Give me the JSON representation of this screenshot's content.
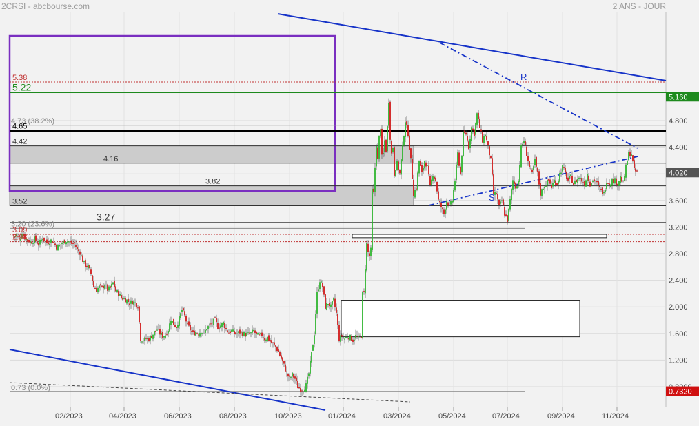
{
  "header": {
    "left": "2CRSI - abcbourse.com",
    "right": "2 ANS - JOUR"
  },
  "chart_data": {
    "type": "candlestick",
    "ylim": [
      0.6,
      5.45
    ],
    "y_ticks": [
      "5.200",
      "4.800",
      "4.400",
      "4.000",
      "3.600",
      "3.200",
      "2.800",
      "2.400",
      "2.000",
      "1.600",
      "1.200",
      "0.8000"
    ],
    "x_ticks": [
      "02/2023",
      "04/2023",
      "06/2023",
      "08/2023",
      "10/2023",
      "01/2024",
      "03/2024",
      "05/2024",
      "07/2024",
      "09/2024",
      "11/2024"
    ],
    "last_price": "4.020",
    "price_tags": [
      {
        "label": "5.160",
        "value": 5.16,
        "color": "#1e8a1e"
      },
      {
        "label": "0.7320",
        "value": 0.732,
        "color": "#d01010"
      }
    ],
    "level_labels": [
      {
        "text": "5.38",
        "value": 5.38,
        "color": "#c03030"
      },
      {
        "text": "5.22",
        "value": 5.22,
        "color": "#1e8a1e"
      },
      {
        "text": "4.73  (38.2%)",
        "value": 4.73,
        "color": "#888888"
      },
      {
        "text": "4.65",
        "value": 4.65,
        "color": "#000000"
      },
      {
        "text": "4.42",
        "value": 4.42,
        "color": "#333333"
      },
      {
        "text": "4.16",
        "value": 4.16,
        "color": "#333333"
      },
      {
        "text": "3.82",
        "value": 3.82,
        "color": "#333333"
      },
      {
        "text": "3.52",
        "value": 3.52,
        "color": "#333333"
      },
      {
        "text": "3.27",
        "value": 3.27,
        "color": "#333333"
      },
      {
        "text": "3.20  (23.6%)",
        "value": 3.18,
        "color": "#888888"
      },
      {
        "text": "3.09",
        "value": 3.09,
        "color": "#c03030"
      },
      {
        "text": "2.98",
        "value": 2.98,
        "color": "#c03030"
      },
      {
        "text": "0.73  (0.0%)",
        "value": 0.73,
        "color": "#888888"
      }
    ],
    "annotations": [
      {
        "text": "R",
        "value": 4.73
      },
      {
        "text": "S",
        "value": 3.18
      }
    ],
    "path_points": [
      [
        0,
        3.05
      ],
      [
        4,
        3.08
      ],
      [
        8,
        3.0
      ],
      [
        12,
        3.12
      ],
      [
        16,
        3.04
      ],
      [
        20,
        3.0
      ],
      [
        26,
        2.98
      ],
      [
        30,
        3.02
      ],
      [
        36,
        2.94
      ],
      [
        42,
        3.04
      ],
      [
        48,
        2.96
      ],
      [
        54,
        3.0
      ],
      [
        58,
        2.97
      ],
      [
        62,
        2.9
      ],
      [
        66,
        2.92
      ],
      [
        70,
        2.96
      ],
      [
        76,
        3.0
      ],
      [
        80,
        2.98
      ],
      [
        84,
        2.95
      ],
      [
        88,
        2.95
      ],
      [
        92,
        2.86
      ],
      [
        96,
        2.82
      ],
      [
        100,
        2.7
      ],
      [
        104,
        2.62
      ],
      [
        108,
        2.6
      ],
      [
        112,
        2.5
      ],
      [
        116,
        2.3
      ],
      [
        120,
        2.26
      ],
      [
        124,
        2.3
      ],
      [
        128,
        2.28
      ],
      [
        132,
        2.34
      ],
      [
        136,
        2.26
      ],
      [
        140,
        2.28
      ],
      [
        144,
        2.36
      ],
      [
        148,
        2.24
      ],
      [
        152,
        2.2
      ],
      [
        156,
        2.14
      ],
      [
        160,
        2.12
      ],
      [
        164,
        2.1
      ],
      [
        168,
        2.06
      ],
      [
        172,
        2.08
      ],
      [
        176,
        2.06
      ],
      [
        180,
        2.02
      ],
      [
        184,
        1.52
      ],
      [
        188,
        1.5
      ],
      [
        192,
        1.52
      ],
      [
        196,
        1.52
      ],
      [
        200,
        1.56
      ],
      [
        204,
        1.62
      ],
      [
        208,
        1.66
      ],
      [
        212,
        1.6
      ],
      [
        216,
        1.56
      ],
      [
        220,
        1.58
      ],
      [
        224,
        1.66
      ],
      [
        228,
        1.82
      ],
      [
        232,
        1.74
      ],
      [
        236,
        1.7
      ],
      [
        240,
        1.82
      ],
      [
        244,
        1.96
      ],
      [
        248,
        1.86
      ],
      [
        252,
        1.72
      ],
      [
        256,
        1.66
      ],
      [
        260,
        1.6
      ],
      [
        264,
        1.62
      ],
      [
        268,
        1.6
      ],
      [
        272,
        1.64
      ],
      [
        276,
        1.6
      ],
      [
        280,
        1.68
      ],
      [
        284,
        1.72
      ],
      [
        288,
        1.76
      ],
      [
        292,
        1.8
      ],
      [
        296,
        1.7
      ],
      [
        300,
        1.72
      ],
      [
        304,
        1.76
      ],
      [
        308,
        1.66
      ],
      [
        312,
        1.62
      ],
      [
        316,
        1.64
      ],
      [
        320,
        1.6
      ],
      [
        324,
        1.6
      ],
      [
        328,
        1.62
      ],
      [
        332,
        1.6
      ],
      [
        336,
        1.58
      ],
      [
        340,
        1.6
      ],
      [
        344,
        1.6
      ],
      [
        348,
        1.64
      ],
      [
        352,
        1.58
      ],
      [
        356,
        1.56
      ],
      [
        360,
        1.58
      ],
      [
        364,
        1.52
      ],
      [
        368,
        1.54
      ],
      [
        372,
        1.48
      ],
      [
        376,
        1.44
      ],
      [
        380,
        1.4
      ],
      [
        384,
        1.32
      ],
      [
        388,
        1.22
      ],
      [
        392,
        1.12
      ],
      [
        396,
        1.0
      ],
      [
        400,
        0.92
      ],
      [
        404,
        0.98
      ],
      [
        408,
        0.92
      ],
      [
        412,
        0.8
      ],
      [
        416,
        0.76
      ],
      [
        420,
        0.76
      ],
      [
        424,
        0.82
      ],
      [
        428,
        1.0
      ],
      [
        432,
        1.3
      ],
      [
        436,
        1.6
      ],
      [
        440,
        2.2
      ],
      [
        444,
        2.4
      ],
      [
        448,
        2.3
      ],
      [
        452,
        2.0
      ],
      [
        456,
        2.06
      ],
      [
        460,
        2.0
      ],
      [
        464,
        2.1
      ],
      [
        468,
        1.9
      ],
      [
        472,
        1.52
      ],
      [
        476,
        1.56
      ],
      [
        480,
        1.52
      ],
      [
        484,
        1.56
      ],
      [
        488,
        1.54
      ],
      [
        492,
        1.5
      ],
      [
        496,
        1.56
      ],
      [
        500,
        1.52
      ],
      [
        504,
        1.58
      ],
      [
        506,
        2.2
      ],
      [
        508,
        2.2
      ],
      [
        510,
        2.6
      ],
      [
        512,
        2.95
      ],
      [
        514,
        2.82
      ],
      [
        516,
        2.76
      ],
      [
        518,
        2.85
      ],
      [
        520,
        3.75
      ],
      [
        522,
        3.7
      ],
      [
        524,
        4.1
      ],
      [
        526,
        4.45
      ],
      [
        528,
        4.2
      ],
      [
        530,
        4.55
      ],
      [
        532,
        4.7
      ],
      [
        534,
        4.25
      ],
      [
        536,
        4.3
      ],
      [
        538,
        4.5
      ],
      [
        540,
        4.35
      ],
      [
        542,
        4.7
      ],
      [
        544,
        5.1
      ],
      [
        546,
        4.55
      ],
      [
        548,
        4.3
      ],
      [
        550,
        4.4
      ],
      [
        552,
        4.0
      ],
      [
        554,
        4.1
      ],
      [
        556,
        4.15
      ],
      [
        560,
        4.0
      ],
      [
        564,
        4.4
      ],
      [
        568,
        4.8
      ],
      [
        572,
        4.6
      ],
      [
        576,
        4.2
      ],
      [
        578,
        3.95
      ],
      [
        580,
        3.7
      ],
      [
        584,
        3.8
      ],
      [
        588,
        4.2
      ],
      [
        592,
        4.0
      ],
      [
        596,
        4.2
      ],
      [
        600,
        4.1
      ],
      [
        604,
        3.8
      ],
      [
        608,
        4.0
      ],
      [
        612,
        3.9
      ],
      [
        616,
        3.6
      ],
      [
        620,
        3.5
      ],
      [
        624,
        3.4
      ],
      [
        628,
        3.6
      ],
      [
        632,
        3.5
      ],
      [
        636,
        3.6
      ],
      [
        640,
        3.9
      ],
      [
        644,
        4.3
      ],
      [
        648,
        4.0
      ],
      [
        652,
        4.6
      ],
      [
        656,
        4.6
      ],
      [
        660,
        4.4
      ],
      [
        664,
        4.7
      ],
      [
        668,
        4.6
      ],
      [
        672,
        4.9
      ],
      [
        676,
        4.7
      ],
      [
        680,
        4.5
      ],
      [
        684,
        4.6
      ],
      [
        688,
        4.4
      ],
      [
        692,
        4.2
      ],
      [
        696,
        3.7
      ],
      [
        700,
        3.7
      ],
      [
        704,
        3.5
      ],
      [
        708,
        3.6
      ],
      [
        712,
        3.4
      ],
      [
        716,
        3.3
      ],
      [
        720,
        3.6
      ],
      [
        724,
        3.9
      ],
      [
        728,
        3.8
      ],
      [
        732,
        3.9
      ],
      [
        736,
        4.4
      ],
      [
        740,
        4.5
      ],
      [
        744,
        4.3
      ],
      [
        748,
        4.1
      ],
      [
        752,
        4.0
      ],
      [
        756,
        4.2
      ],
      [
        760,
        4.0
      ],
      [
        764,
        3.7
      ],
      [
        768,
        3.8
      ],
      [
        772,
        3.85
      ],
      [
        776,
        3.9
      ],
      [
        780,
        3.8
      ],
      [
        784,
        3.9
      ],
      [
        788,
        3.85
      ],
      [
        792,
        4.0
      ],
      [
        796,
        4.1
      ],
      [
        800,
        4.0
      ],
      [
        804,
        3.9
      ],
      [
        808,
        3.95
      ],
      [
        812,
        3.85
      ],
      [
        816,
        3.9
      ],
      [
        820,
        3.95
      ],
      [
        824,
        3.9
      ],
      [
        828,
        3.85
      ],
      [
        832,
        4.0
      ],
      [
        836,
        3.85
      ],
      [
        840,
        3.9
      ],
      [
        844,
        3.9
      ],
      [
        848,
        3.8
      ],
      [
        852,
        3.75
      ],
      [
        856,
        3.7
      ],
      [
        860,
        3.9
      ],
      [
        864,
        3.85
      ],
      [
        868,
        3.9
      ],
      [
        872,
        3.9
      ],
      [
        876,
        3.85
      ],
      [
        880,
        3.95
      ],
      [
        884,
        3.85
      ],
      [
        888,
        4.1
      ],
      [
        892,
        4.3
      ],
      [
        896,
        4.3
      ],
      [
        900,
        4.05
      ],
      [
        904,
        4.02
      ]
    ]
  }
}
